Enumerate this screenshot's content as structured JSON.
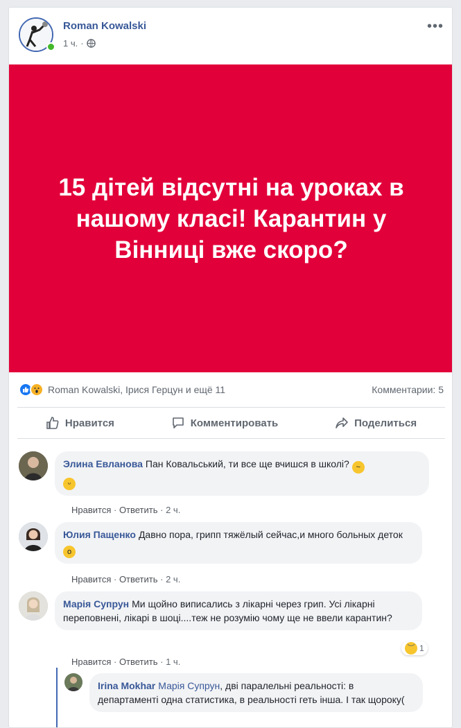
{
  "post": {
    "author": "Roman Kowalski",
    "time": "1 ч.",
    "separator": "·",
    "more": "•••",
    "image_text": "15 дітей відсутні на уроках в нашому класі! Карантин у Вінниці вже скоро?",
    "reactions_text": "Roman Kowalski, Ірися Герцун и ещё 11",
    "comments_count": "Комментарии: 5"
  },
  "actions": {
    "like": "Нравится",
    "comment": "Комментировать",
    "share": "Поделиться"
  },
  "comments": [
    {
      "name": "Элина Евланова",
      "text": "Пан Ковальський, ти все ще вчишся в школі?",
      "like": "Нравится",
      "reply": "Ответить",
      "time": "2 ч."
    },
    {
      "name": "Юлия Пащенко",
      "text": "Давно пора, грипп тяжёлый сейчас,и много больных деток",
      "like": "Нравится",
      "reply": "Ответить",
      "time": "2 ч."
    },
    {
      "name": "Марія Супрун",
      "text": "Ми щойно виписались з лікарні через грип. Усі лікарні переповнені, лікарі в шоці....теж не розумію чому ще не ввели карантин?",
      "like": "Нравится",
      "reply": "Ответить",
      "time": "1 ч.",
      "reaction_count": "1"
    }
  ],
  "reply": {
    "name": "Irina Mokhar",
    "tag": "Марія Супрун",
    "text": ", дві паралельні реальності: в департаменті одна статистика, в реальності геть інша. І так щороку("
  },
  "colors": {
    "post_bg": "#e2003a",
    "link": "#385898",
    "online": "#42b72a"
  }
}
